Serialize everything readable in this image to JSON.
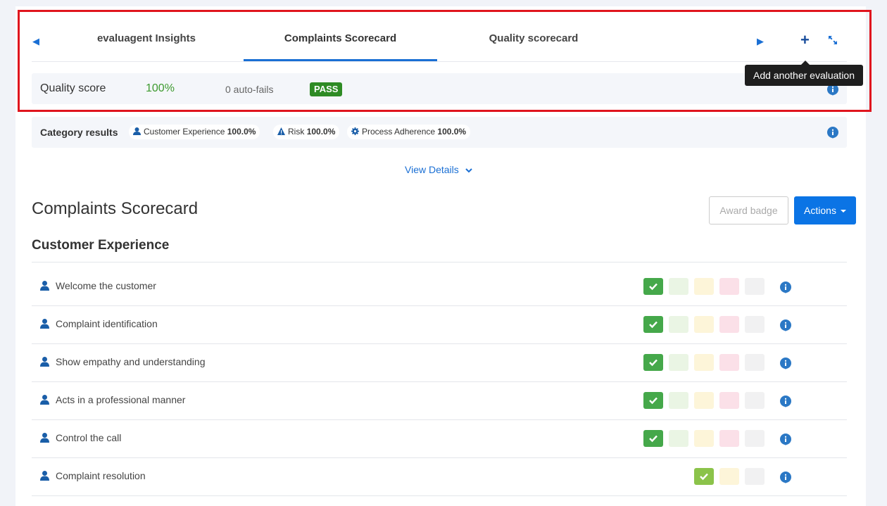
{
  "tabs": {
    "items": [
      {
        "label": "evaluagent Insights"
      },
      {
        "label": "Complaints Scorecard"
      },
      {
        "label": "Quality scorecard"
      }
    ],
    "tooltip": "Add another evaluation",
    "plus_glyph": "+"
  },
  "quality": {
    "label": "Quality score",
    "value": "100%",
    "autofails": "0 auto-fails",
    "badge": "PASS"
  },
  "categories": {
    "label": "Category results",
    "items": [
      {
        "icon": "person-icon",
        "name": "Customer Experience",
        "value": "100.0%"
      },
      {
        "icon": "warning-icon",
        "name": "Risk",
        "value": "100.0%"
      },
      {
        "icon": "gear-icon",
        "name": "Process Adherence",
        "value": "100.0%"
      }
    ]
  },
  "view_details": "View Details",
  "scorecard": {
    "title": "Complaints Scorecard",
    "award_badge": "Award badge",
    "actions": "Actions"
  },
  "section": {
    "title": "Customer Experience",
    "rows": [
      {
        "label": "Welcome the customer"
      },
      {
        "label": "Complaint identification"
      },
      {
        "label": "Show empathy and understanding"
      },
      {
        "label": "Acts in a professional manner"
      },
      {
        "label": "Control the call"
      },
      {
        "label": "Complaint resolution"
      }
    ]
  },
  "colors": {
    "accent": "#0b74e5",
    "pass": "#2e8b24",
    "highlight": "#e0151e"
  }
}
